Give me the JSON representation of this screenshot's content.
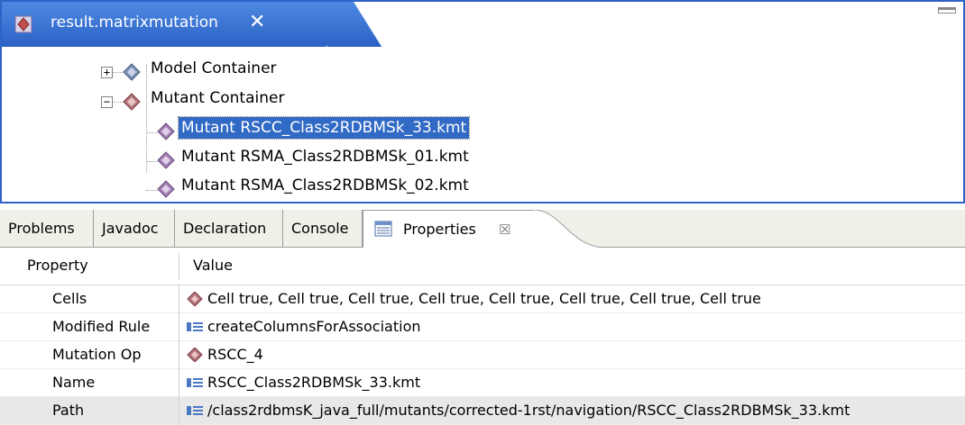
{
  "editor": {
    "tab_title": "result.matrixmutation",
    "close_glyph": "✕",
    "tab_icon": "matrix-model-icon",
    "tree": [
      {
        "label": "Model Container",
        "expander": "+",
        "icon": "diamond-blue-icon",
        "selected": false
      },
      {
        "label": "Mutant Container",
        "expander": "−",
        "icon": "diamond-red-icon",
        "selected": false
      },
      {
        "label": "Mutant RSCC_Class2RDBMSk_33.kmt",
        "icon": "diamond-purple-icon",
        "selected": true
      },
      {
        "label": "Mutant RSMA_Class2RDBMSk_01.kmt",
        "icon": "diamond-purple-icon",
        "selected": false
      },
      {
        "label": "Mutant RSMA_Class2RDBMSk_02.kmt",
        "icon": "diamond-purple-icon",
        "selected": false
      }
    ]
  },
  "views": {
    "tabs": [
      "Problems",
      "Javadoc",
      "Declaration",
      "Console"
    ],
    "active_tab": "Properties",
    "active_close_glyph": "☒"
  },
  "properties": {
    "col_property": "Property",
    "col_value": "Value",
    "rows": [
      {
        "name": "Cells",
        "value": "Cell true, Cell true, Cell true, Cell true, Cell true, Cell true, Cell true, Cell true",
        "icon": "diamond-red-icon"
      },
      {
        "name": "Modified Rule",
        "value": "createColumnsForAssociation",
        "icon": "text-field-icon"
      },
      {
        "name": "Mutation Op",
        "value": "RSCC_4",
        "icon": "diamond-red-icon"
      },
      {
        "name": "Name",
        "value": "RSCC_Class2RDBMSk_33.kmt",
        "icon": "text-field-icon"
      },
      {
        "name": "Path",
        "value": "/class2rdbmsK_java_full/mutants/corrected-1rst/navigation/RSCC_Class2RDBMSk_33.kmt",
        "icon": "text-field-icon"
      }
    ]
  },
  "colors": {
    "tab_blue": "#2c62c6",
    "selection": "#316ac5",
    "row_highlight": "#e8e8e8"
  }
}
